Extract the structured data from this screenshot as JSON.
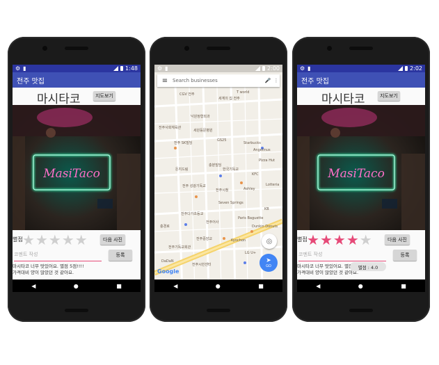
{
  "phones": [
    {
      "status_time": "1:48",
      "app_title": "전주 맛집",
      "shop_name": "마시타코",
      "map_button": "지도보기",
      "rating_label": "별점",
      "next_photo_button": "다음 사진",
      "comment_placeholder": "코멘트 작성",
      "register_button": "등록",
      "rating": 0,
      "review_lines": [
        "마시타코 너무 맛있어요. 별점 5점!!!!",
        "가격대비 양이 많았던 것 같아요."
      ]
    },
    {
      "status_time": "2:00",
      "search_placeholder": "Search businesses",
      "map_labels": [
        "CGV 전주",
        "세계의 집 전주",
        "T world",
        "낙원정형외과",
        "전주사회체육관",
        "세원등문병원",
        "GS25",
        "전주 SK빌딩",
        "Starbucks",
        "Angelinus",
        "Pizza Hut",
        "돈지드림",
        "충분빌딩",
        "한국기독교",
        "전주 성광기독교",
        "KFC",
        "Lotteria",
        "전주시청",
        "Ashley",
        "Seven Springs",
        "Paris Baguette",
        "Dunkin Donuts",
        "KB",
        "전주어사",
        "충경로",
        "전주다가초등교",
        "전주중앙교",
        "Kyochon",
        "전주기독교회관",
        "LG U+",
        "전주시민센터",
        "DaDaN"
      ],
      "go_label": "GO",
      "google_logo": "Google"
    },
    {
      "status_time": "2:02",
      "app_title": "전주 맛집",
      "shop_name": "마시타코",
      "map_button": "지도보기",
      "rating_label": "별점",
      "next_photo_button": "다음 사진",
      "comment_placeholder": "코멘트 작성",
      "register_button": "등록",
      "rating": 4,
      "toast": "별점 : 4.0",
      "review_lines": [
        "마시타코 너무 맛있어요. 별점 5점!!!!",
        "가격대비 양이 많았던 것 같아요."
      ]
    }
  ],
  "neon_text": "MasiTaco",
  "colors": {
    "status_bar": "#2b35a0",
    "app_bar": "#3f51b5",
    "star_active": "#e64a78",
    "star_inactive": "#cfcfcf",
    "neon_green": "#38e0a0",
    "neon_pink": "#ff6fc8"
  }
}
